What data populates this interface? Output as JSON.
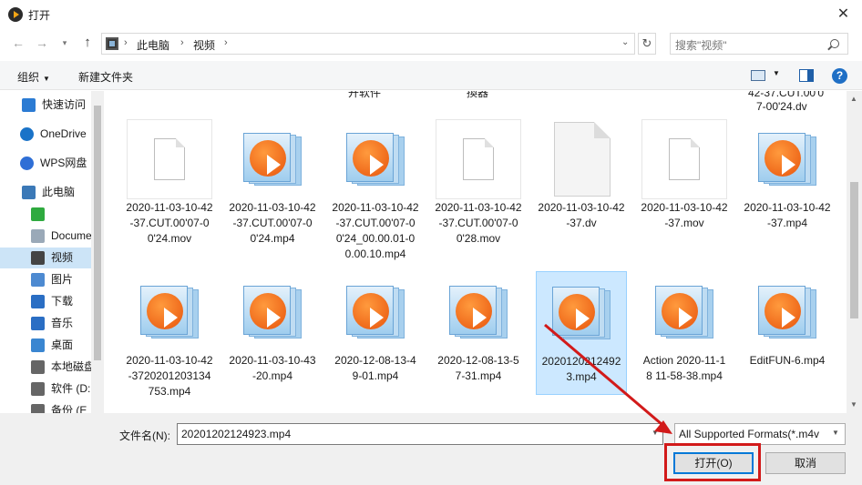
{
  "window": {
    "title": "打开",
    "close": "✕"
  },
  "nav": {
    "back": "←",
    "forward": "→",
    "recent": "▾",
    "up": "↑",
    "breadcrumb": [
      "此电脑",
      "视频"
    ],
    "sep": "›",
    "dropdown": "⌄",
    "refresh": "↻",
    "search_placeholder": "搜索\"视频\""
  },
  "toolbar": {
    "organize": "组织",
    "new_folder": "新建文件夹",
    "caret": "▼",
    "help": "?"
  },
  "sidebar": {
    "items": [
      {
        "label": "快速访问",
        "icon": "star-icon"
      },
      {
        "label": "OneDrive",
        "icon": "cloud-icon"
      },
      {
        "label": "WPS网盘",
        "icon": "wps-cloud-icon"
      },
      {
        "label": "此电脑",
        "icon": "computer-icon"
      },
      {
        "label": "",
        "icon": "green-app-icon"
      },
      {
        "label": "Docume",
        "icon": "document-icon"
      },
      {
        "label": "视频",
        "icon": "video-folder-icon"
      },
      {
        "label": "图片",
        "icon": "pictures-icon"
      },
      {
        "label": "下载",
        "icon": "download-icon"
      },
      {
        "label": "音乐",
        "icon": "music-icon"
      },
      {
        "label": "桌面",
        "icon": "desktop-icon"
      },
      {
        "label": "本地磁盘",
        "icon": "drive-icon"
      },
      {
        "label": "软件 (D:",
        "icon": "drive-icon"
      },
      {
        "label": "备份 (E",
        "icon": "drive-icon"
      }
    ]
  },
  "partial_top": [
    "开软件",
    "換器",
    "42-37.CUT.00'0",
    "7-00'24.dv"
  ],
  "files": [
    {
      "name": "2020-11-03-10-42-37.CUT.00'07-00'24.mov",
      "type": "doc"
    },
    {
      "name": "2020-11-03-10-42-37.CUT.00'07-00'24.mp4",
      "type": "media"
    },
    {
      "name": "2020-11-03-10-42-37.CUT.00'07-00'24_00.00.01-00.00.10.mp4",
      "type": "media"
    },
    {
      "name": "2020-11-03-10-42-37.CUT.00'07-00'28.mov",
      "type": "doc"
    },
    {
      "name": "2020-11-03-10-42-37.dv",
      "type": "bigdoc"
    },
    {
      "name": "2020-11-03-10-42-37.mov",
      "type": "doc"
    },
    {
      "name": "2020-11-03-10-42-37.mp4",
      "type": "media"
    },
    {
      "name": "2020-11-03-10-42-3720201203134753.mp4",
      "type": "media"
    },
    {
      "name": "2020-11-03-10-43-20.mp4",
      "type": "media"
    },
    {
      "name": "2020-12-08-13-49-01.mp4",
      "type": "media"
    },
    {
      "name": "2020-12-08-13-57-31.mp4",
      "type": "media"
    },
    {
      "name": "20201202124923.mp4",
      "type": "media",
      "selected": true
    },
    {
      "name": "Action 2020-11-18 11-58-38.mp4",
      "type": "media"
    },
    {
      "name": "EditFUN-6.mp4",
      "type": "media"
    }
  ],
  "footer": {
    "filename_label": "文件名(N):",
    "filename_value": "20201202124923.mp4",
    "filter": "All Supported Formats(*.m4v",
    "open": "打开(O)",
    "cancel": "取消",
    "drop": "▼"
  },
  "colors": {
    "selection": "#cce8ff",
    "accent": "#0078d7",
    "annotation": "#d21a1a"
  }
}
